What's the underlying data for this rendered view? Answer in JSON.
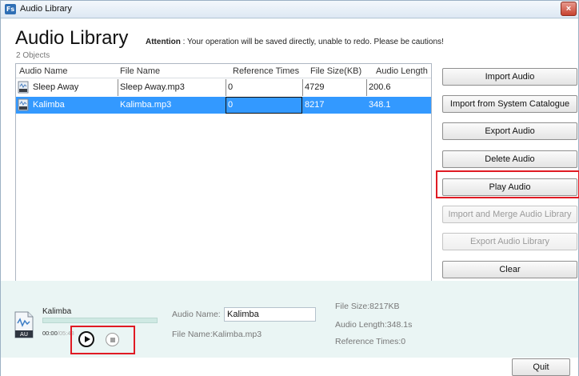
{
  "window": {
    "icon_text": "Fs",
    "title": "Audio Library",
    "close": "×"
  },
  "header": {
    "title": "Audio Library",
    "attention_label": "Attention",
    "attention_text": " : Your operation will be saved directly, unable to redo. Please be cautions!",
    "object_count": "2 Objects"
  },
  "table": {
    "columns": [
      "Audio Name",
      "File Name",
      "Reference Times",
      "File Size(KB)",
      "Audio Length"
    ],
    "rows": [
      {
        "name": "Sleep Away",
        "file": "Sleep Away.mp3",
        "refs": "0",
        "size": "4729",
        "length": "200.6",
        "selected": false
      },
      {
        "name": "Kalimba",
        "file": "Kalimba.mp3",
        "refs": "0",
        "size": "8217",
        "length": "348.1",
        "selected": true
      }
    ]
  },
  "actions": {
    "import_audio": "Import Audio",
    "import_catalogue": "Import from System Catalogue",
    "export_audio": "Export Audio",
    "delete_audio": "Delete Audio",
    "play_audio": "Play Audio",
    "import_merge": "Import and Merge Audio Library",
    "export_library": "Export Audio Library",
    "clear": "Clear"
  },
  "player": {
    "track_name": "Kalimba",
    "elapsed": "00:00",
    "total": "/05:48",
    "progress": 0,
    "badge": "AU"
  },
  "details": {
    "audio_name_label": "Audio Name:",
    "audio_name_value": "Kalimba",
    "file_name": "File Name:Kalimba.mp3",
    "file_size": "File Size:8217KB",
    "audio_length": "Audio Length:348.1s",
    "reference_times": "Reference Times:0"
  },
  "footer": {
    "quit": "Quit"
  },
  "colors": {
    "selection": "#3399ff",
    "highlight": "#e01b24",
    "panel": "#eaf5f4"
  }
}
